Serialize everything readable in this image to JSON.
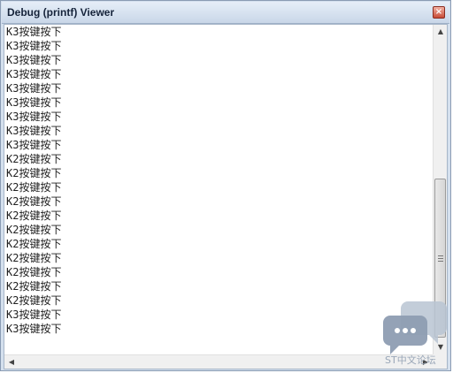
{
  "window": {
    "title": "Debug (printf) Viewer",
    "close_glyph": "×"
  },
  "lines": [
    "K3按键按下",
    "K3按键按下",
    "K3按键按下",
    "K3按键按下",
    "K3按键按下",
    "K3按键按下",
    "K3按键按下",
    "K3按键按下",
    "K3按键按下",
    "K2按键按下",
    "K2按键按下",
    "K2按键按下",
    "K2按键按下",
    "K2按键按下",
    "K2按键按下",
    "K2按键按下",
    "K2按键按下",
    "K2按键按下",
    "K2按键按下",
    "K2按键按下",
    "K3按键按下",
    "K3按键按下"
  ],
  "scrollbar": {
    "up_glyph": "▲",
    "down_glyph": "▼",
    "left_glyph": "◀",
    "right_glyph": "▶"
  },
  "watermark": {
    "text": "ST中文论坛",
    "icon": "chat-bubbles-icon",
    "color": "#9aa7b8"
  }
}
